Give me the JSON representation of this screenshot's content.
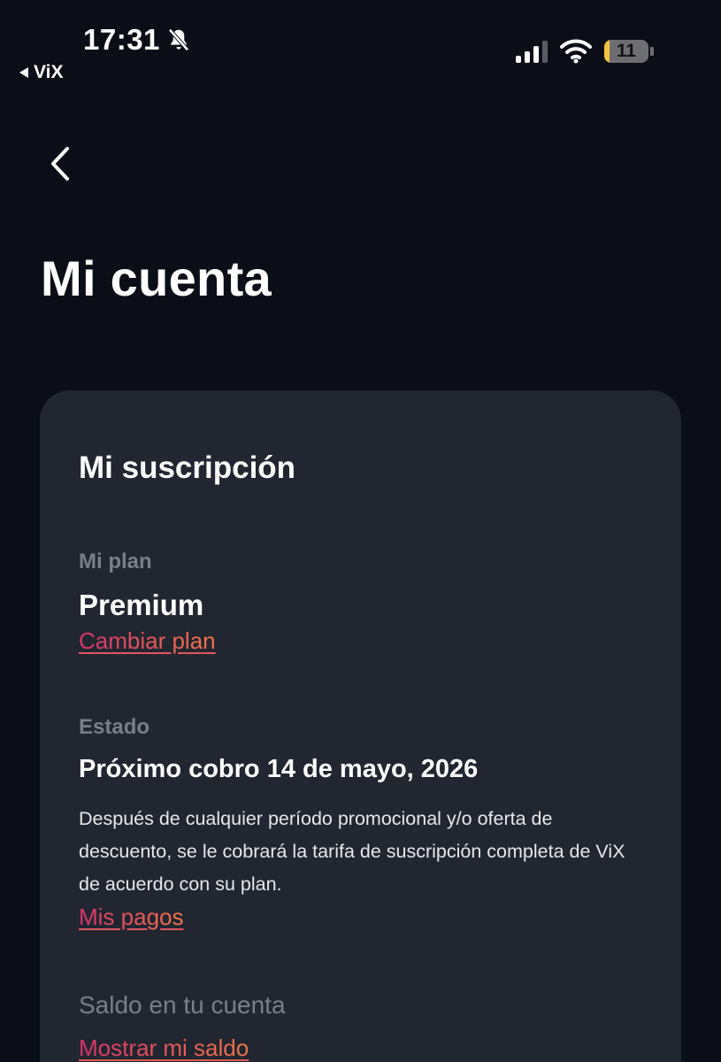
{
  "status_bar": {
    "time": "17:31",
    "back_app": "ViX",
    "battery": "11",
    "battery_level": 0.11
  },
  "header": {
    "title": "Mi cuenta"
  },
  "subscription": {
    "title": "Mi suscripción",
    "plan_label": "Mi plan",
    "plan_value": "Premium",
    "change_plan_link": "Cambiar plan",
    "status_label": "Estado",
    "status_value": "Próximo cobro 14 de mayo, 2026",
    "description": "Después de cualquier período promocional y/o oferta de descuento, se le cobrará la tarifa de suscripción completa de ViX de acuerdo con su plan.",
    "payments_link": "Mis pagos",
    "balance_label": "Saldo en tu cuenta",
    "balance_link": "Mostrar mi saldo"
  },
  "colors": {
    "background": "#0b0e16",
    "card": "#222630",
    "link_start": "#d6336c",
    "link_end": "#f0764a",
    "muted": "#7a7e88"
  },
  "icons": [
    "bell-slash-icon",
    "cellular-signal-icon",
    "wifi-icon",
    "battery-icon",
    "chevron-left-icon"
  ]
}
